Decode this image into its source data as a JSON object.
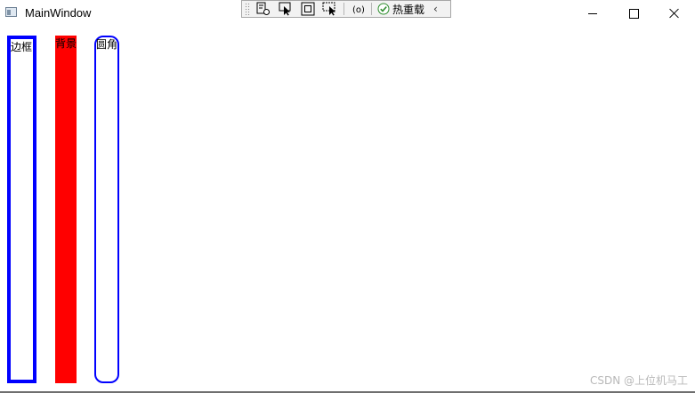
{
  "window": {
    "title": "MainWindow",
    "icon": "window-app-icon",
    "controls": [
      "minimize-icon",
      "maximize-icon",
      "close-icon"
    ]
  },
  "runtime_toolbar": {
    "items": [
      "live-visual-tree-icon",
      "select-element-icon",
      "display-layout-adorners-icon",
      "track-focus-icon",
      "binding-failures-icon"
    ],
    "hot_reload_label": "热重载",
    "hot_reload_status": "checkmark-icon",
    "collapse_icon": "chevron-left-icon"
  },
  "demos": {
    "border_label": "边框",
    "background_label": "背景",
    "corner_label": "圆角"
  },
  "colors": {
    "border": "#0000ff",
    "background": "#ff0000",
    "corner": "#0000ff"
  },
  "watermark": "CSDN @上位机马工"
}
